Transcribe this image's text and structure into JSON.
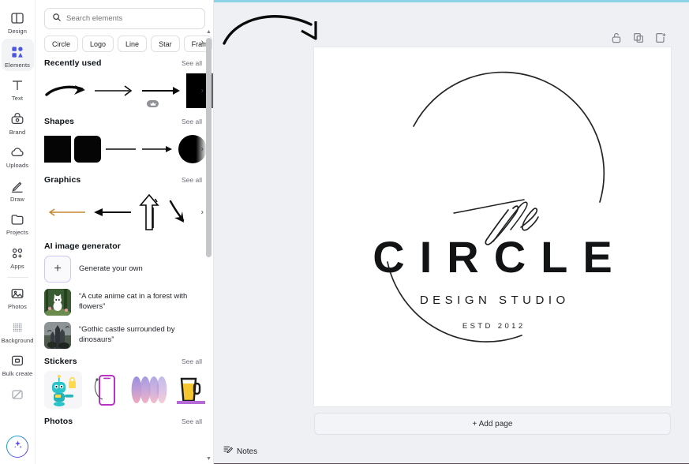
{
  "rail": {
    "items": [
      {
        "label": "Design",
        "icon": "design-icon",
        "active": false
      },
      {
        "label": "Elements",
        "icon": "elements-icon",
        "active": true
      },
      {
        "label": "Text",
        "icon": "text-icon",
        "active": false
      },
      {
        "label": "Brand",
        "icon": "brand-icon",
        "active": false
      },
      {
        "label": "Uploads",
        "icon": "uploads-icon",
        "active": false
      },
      {
        "label": "Draw",
        "icon": "draw-icon",
        "active": false
      },
      {
        "label": "Projects",
        "icon": "projects-icon",
        "active": false
      },
      {
        "label": "Apps",
        "icon": "apps-icon",
        "active": false
      },
      {
        "label": "Photos",
        "icon": "photos-icon",
        "active": false
      },
      {
        "label": "Background",
        "icon": "background-icon",
        "active": false
      },
      {
        "label": "Bulk create",
        "icon": "bulk-create-icon",
        "active": false
      }
    ],
    "magic_button_icon": "magic-sparkle-icon"
  },
  "search": {
    "placeholder": "Search elements",
    "value": "",
    "icon": "search-icon"
  },
  "chips": [
    {
      "label": "Circle"
    },
    {
      "label": "Logo"
    },
    {
      "label": "Line"
    },
    {
      "label": "Star"
    },
    {
      "label": "Frame"
    }
  ],
  "chips_more_icon": "chevron-right-icon",
  "sections": {
    "recently_used": {
      "title": "Recently used",
      "see_all": "See all",
      "items": [
        "curved-bold-arrow",
        "thin-arrow-right",
        "thin-arrow-right-2",
        "black-gradient-rect"
      ],
      "badge": "crown-icon"
    },
    "shapes": {
      "title": "Shapes",
      "see_all": "See all",
      "items": [
        "square-shape",
        "rounded-square-shape",
        "line-shape",
        "arrow-shape",
        "circle-shape"
      ]
    },
    "graphics": {
      "title": "Graphics",
      "see_all": "See all",
      "items": [
        "orange-thin-arrow-left",
        "black-arrow-left",
        "doodle-up-arrow",
        "sketch-down-arrow"
      ]
    },
    "ai": {
      "title": "AI image generator",
      "generate_label": "Generate your own",
      "generate_icon": "plus-icon",
      "prompts": [
        {
          "text": "“A cute anime cat in a forest with flowers”",
          "thumb": "anime-cat-thumb"
        },
        {
          "text": "“Gothic castle surrounded by dinosaurs”",
          "thumb": "gothic-castle-thumb"
        }
      ]
    },
    "stickers": {
      "title": "Stickers",
      "see_all": "See all",
      "items": [
        "robot-lock-sticker",
        "phone-sticker",
        "gradient-ellipses-sticker",
        "beer-glass-sticker"
      ]
    },
    "photos": {
      "title": "Photos",
      "see_all": "See all"
    }
  },
  "canvas": {
    "tools": [
      {
        "name": "lock-icon"
      },
      {
        "name": "duplicate-page-icon"
      },
      {
        "name": "add-page-icon"
      }
    ],
    "logo": {
      "script_word": "The",
      "title": "CIRCLE",
      "subtitle": "DESIGN STUDIO",
      "established": "ESTD 2012"
    },
    "add_page_label": "+ Add page",
    "notes_label": "Notes",
    "notes_icon": "notes-icon",
    "annotation_icon": "curved-arrow-annotation"
  },
  "colors": {
    "accent": "#7d2ae8",
    "teal": "#00c4cc",
    "panel_bg": "#ffffff",
    "editor_bg": "#eff0f4",
    "top_strip": "#8bd3e6",
    "logo_ink": "#111315",
    "orange_arrow": "#c8862f"
  }
}
